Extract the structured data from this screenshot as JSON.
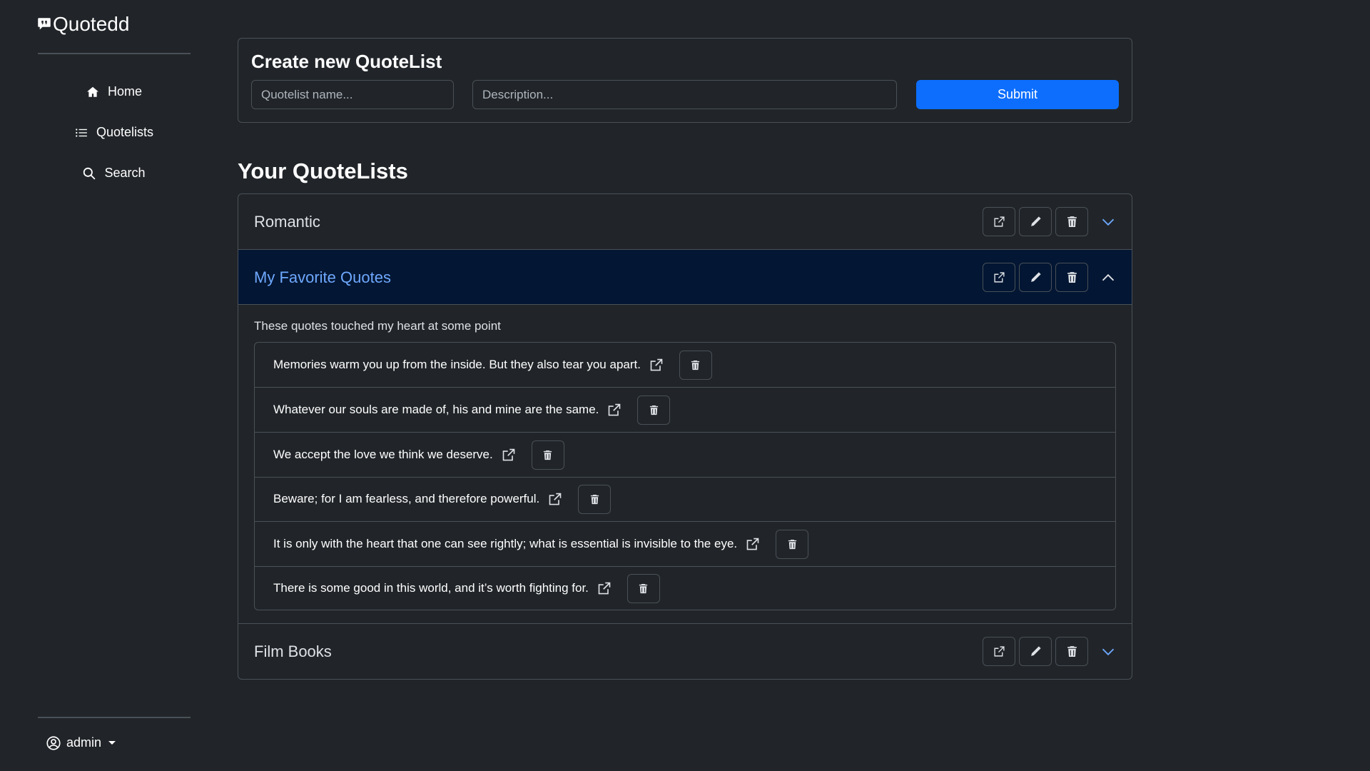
{
  "app": {
    "brand": "Quotedd"
  },
  "sidebar": {
    "items": [
      {
        "label": "Home",
        "icon": "home-icon"
      },
      {
        "label": "Quotelists",
        "icon": "list-icon"
      },
      {
        "label": "Search",
        "icon": "search-icon"
      }
    ],
    "user": {
      "label": "admin",
      "icon": "user-circle-icon"
    }
  },
  "create": {
    "title": "Create new QuoteList",
    "name_placeholder": "Quotelist name...",
    "name_value": "",
    "description_placeholder": "Description...",
    "description_value": "",
    "submit_label": "Submit"
  },
  "lists_section": {
    "title": "Your QuoteLists"
  },
  "quotelists": [
    {
      "name": "Romantic",
      "expanded": false
    },
    {
      "name": "My Favorite Quotes",
      "expanded": true,
      "description": "These quotes touched my heart at some point",
      "quotes": [
        "Memories warm you up from the inside. But they also tear you apart.",
        "Whatever our souls are made of, his and mine are the same.",
        "We accept the love we think we deserve.",
        "Beware; for I am fearless, and therefore powerful.",
        "It is only with the heart that one can see rightly; what is essential is invisible to the eye.",
        "There is some good in this world, and it’s worth fighting for."
      ]
    },
    {
      "name": "Film Books",
      "expanded": false
    }
  ],
  "colors": {
    "background": "#212529",
    "border": "#495057",
    "primary": "#0d6efd",
    "active_header_bg": "#031633",
    "active_header_text": "#6ea8fe"
  }
}
